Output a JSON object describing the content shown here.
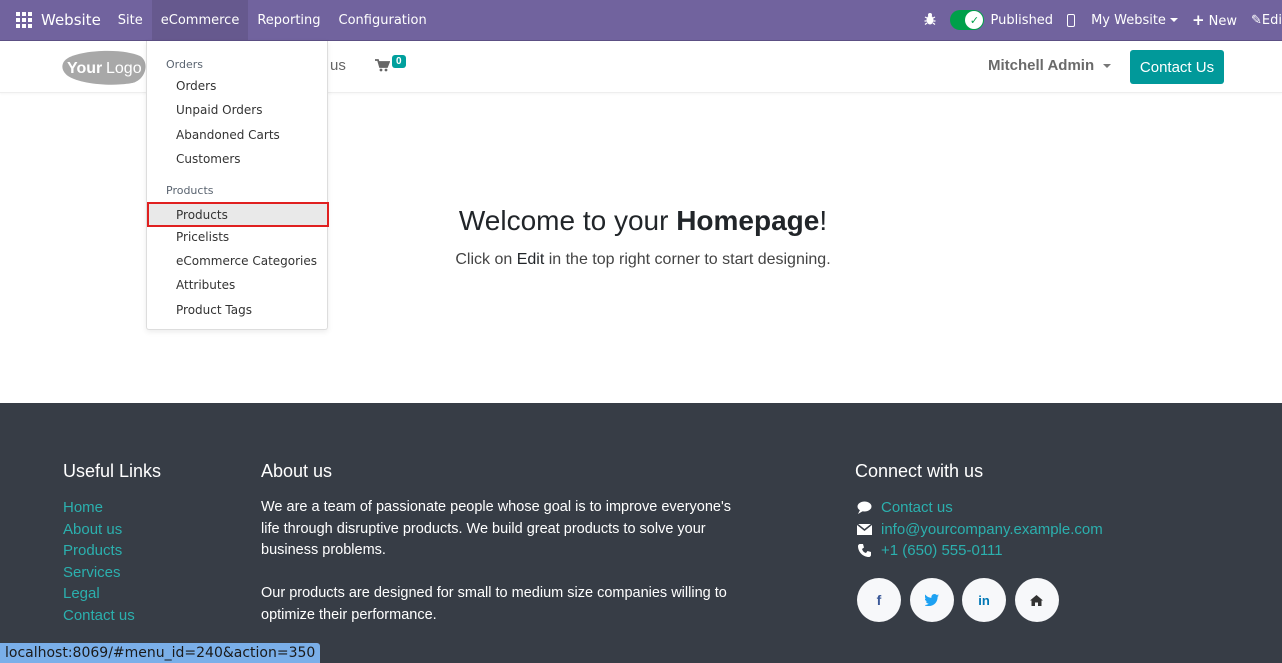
{
  "navbar": {
    "app_name": "Website",
    "menu": [
      "Site",
      "eCommerce",
      "Reporting",
      "Configuration"
    ],
    "active_menu": "eCommerce",
    "published_label": "Published",
    "published": true,
    "website_selector": "My Website",
    "new_label": "New",
    "edit_label": "Edi"
  },
  "site_header": {
    "logo_text": "YourLogo",
    "menu_fragment": "us",
    "cart_count": "0",
    "user_name": "Mitchell Admin",
    "contact_button": "Contact Us"
  },
  "dropdown": {
    "sections": [
      {
        "header": "Orders",
        "items": [
          "Orders",
          "Unpaid Orders",
          "Abandoned Carts",
          "Customers"
        ]
      },
      {
        "header": "Products",
        "items": [
          "Products",
          "Pricelists",
          "eCommerce Categories",
          "Attributes",
          "Product Tags"
        ]
      }
    ],
    "highlighted_item": "Products"
  },
  "hero": {
    "title_prefix": "Welcome to your ",
    "title_bold": "Homepage",
    "title_suffix": "!",
    "sub_prefix": "Click on ",
    "sub_bold": "Edit",
    "sub_suffix": " in the top right corner to start designing."
  },
  "footer": {
    "useful_links": {
      "title": "Useful Links",
      "links": [
        "Home",
        "About us",
        "Products",
        "Services",
        "Legal",
        "Contact us"
      ]
    },
    "about": {
      "title": "About us",
      "paragraphs": [
        "We are a team of passionate people whose goal is to improve everyone's life through disruptive products. We build great products to solve your business problems.",
        "Our products are designed for small to medium size companies willing to optimize their performance."
      ]
    },
    "connect": {
      "title": "Connect with us",
      "items": [
        {
          "icon": "comment-icon",
          "text": "Contact us"
        },
        {
          "icon": "envelope-icon",
          "text": "info@yourcompany.example.com"
        },
        {
          "icon": "phone-icon",
          "text": "+1 (650) 555-0111"
        }
      ],
      "social": [
        "facebook",
        "twitter",
        "linkedin",
        "home"
      ]
    }
  },
  "status_bar": {
    "url": "localhost:8069/#menu_id=240&action=350"
  },
  "colors": {
    "navbar": "#71639e",
    "accent": "#01999a",
    "footer_bg": "#373d46",
    "footer_link": "#2bb0ae",
    "highlight_border": "#e02020"
  }
}
